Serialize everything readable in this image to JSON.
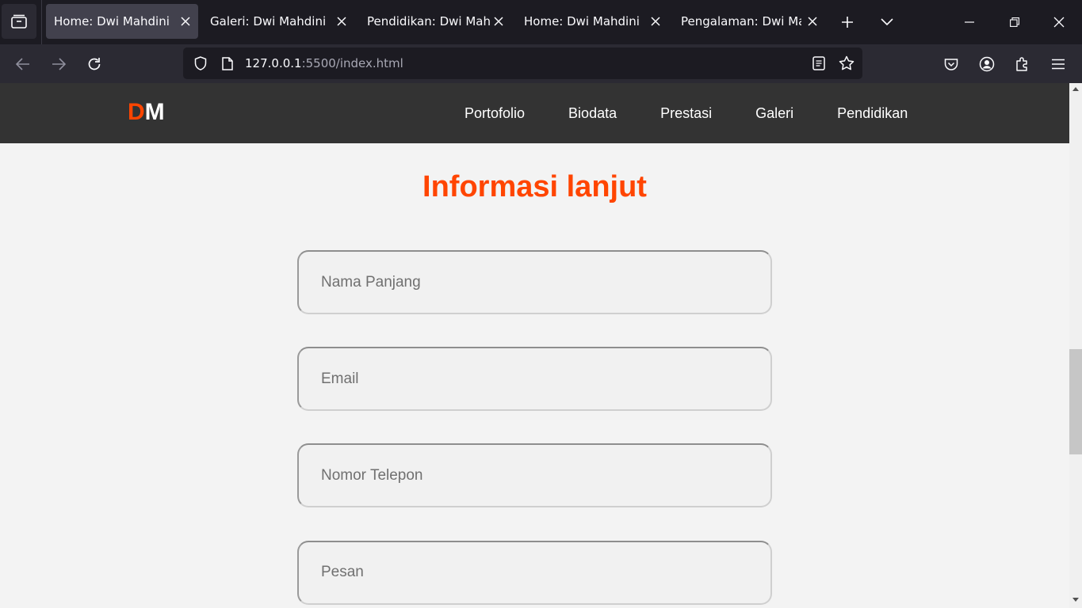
{
  "browser": {
    "tabs": [
      {
        "title": "Home: Dwi Mahdini",
        "active": true
      },
      {
        "title": "Galeri: Dwi Mahdini",
        "active": false
      },
      {
        "title": "Pendidikan: Dwi Mahdini",
        "active": false
      },
      {
        "title": "Home: Dwi Mahdini",
        "active": false
      },
      {
        "title": "Pengalaman: Dwi Mahdini",
        "active": false
      }
    ],
    "url_host": "127.0.0.1",
    "url_rest": ":5500/index.html",
    "icons": [
      "tab-list-icon",
      "new-tab-icon",
      "tab-overflow-icon",
      "minimize-icon",
      "restore-icon",
      "close-window-icon",
      "back-icon",
      "forward-icon",
      "reload-icon",
      "shield-icon",
      "page-icon",
      "reader-view-icon",
      "bookmark-star-icon",
      "pocket-icon",
      "account-icon",
      "extensions-icon",
      "menu-icon"
    ]
  },
  "site": {
    "logo_first": "D",
    "logo_second": "M",
    "nav": [
      "Portofolio",
      "Biodata",
      "Prestasi",
      "Galeri",
      "Pendidikan"
    ],
    "accent_color": "#ff4500",
    "header_color": "#333333"
  },
  "form": {
    "title": "Informasi lanjut",
    "name_placeholder": "Nama Panjang",
    "email_placeholder": "Email",
    "phone_placeholder": "Nomor Telepon",
    "message_placeholder": "Pesan"
  }
}
